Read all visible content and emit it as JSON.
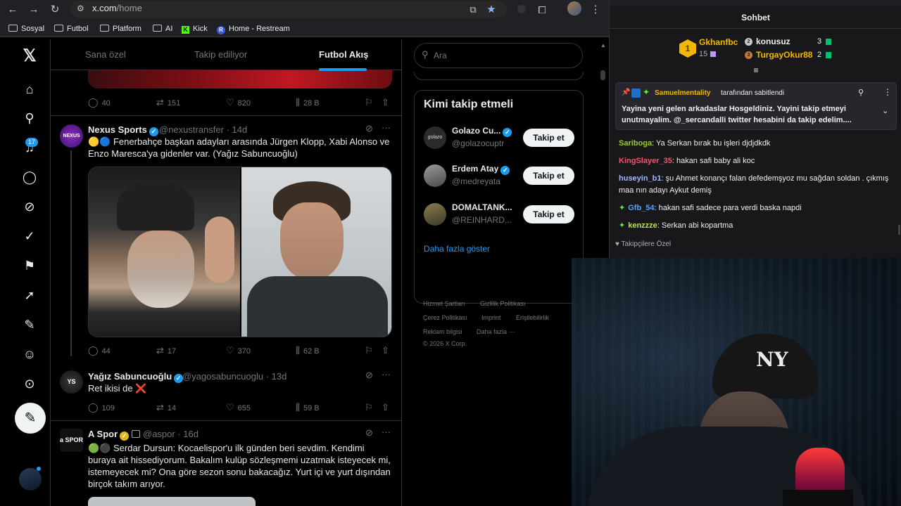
{
  "browser": {
    "url_domain": "x.com",
    "url_path": "/home",
    "bookmarks": [
      "Sosyal",
      "Futbol",
      "Platform",
      "AI",
      "Kick",
      "Home - Restream"
    ]
  },
  "twitter": {
    "tabs": [
      "Sana özel",
      "Takip ediliyor",
      "Futbol Akış"
    ],
    "notifications_badge": "17",
    "post0": {
      "replies": "40",
      "reposts": "151",
      "likes": "820",
      "views": "28 B"
    },
    "post1": {
      "name": "Nexus Sports",
      "avatar_text": "NEXUS",
      "handle_time": "@nexustransfer · 14d",
      "text": "🟡🔵 Fenerbahçe başkan adayları arasında Jürgen Klopp, Xabi Alonso ve Enzo  Maresca'ya gidenler var. (Yağız Sabuncuoğlu)",
      "replies": "44",
      "reposts": "17",
      "likes": "370",
      "views": "62 B"
    },
    "post2": {
      "name": "Yağız Sabuncuoğlu",
      "avatar_text": "YS",
      "handle_time": "@yagosabuncuoglu · 13d",
      "text": "Ret ikisi de ❌",
      "replies": "109",
      "reposts": "14",
      "likes": "655",
      "views": "59 B"
    },
    "post3": {
      "name": "A Spor",
      "avatar_text": "a SPOR",
      "handle_time": "@aspor · 16d",
      "text": "🟢⚫ Serdar Dursun: Kocaelispor'u ilk günden beri sevdim. Kendimi buraya ait hissediyorum. Bakalım kulüp sözleşmemi uzatmak isteyecek mi, istemeyecek mi? Ona göre sezon sonu bakacağız. Yurt içi ve yurt dışından birçok takım arıyor."
    },
    "search_placeholder": "Ara",
    "who_to_follow": {
      "title": "Kimi takip etmeli",
      "button": "Takip et",
      "show_more": "Daha fazla göster",
      "accounts": [
        {
          "name": "Golazo Cu...",
          "handle": "@golazocuptr",
          "avatar_text": "golazo"
        },
        {
          "name": "Erdem Atay",
          "handle": "@medreyata",
          "avatar_text": ""
        },
        {
          "name": "DOMALTANK...",
          "handle": "@REINHARD...",
          "avatar_text": ""
        }
      ]
    },
    "footer": {
      "links": [
        "Hizmet Şartları",
        "Gizlilik Politikası",
        "Çerez Politikası",
        "Imprint",
        "Erişilebilirlik",
        "Reklam bilgisi",
        "Daha fazla ···"
      ],
      "copyright": "© 2026 X Corp."
    }
  },
  "chat": {
    "header_title": "Sohbet",
    "leaderboard": {
      "rank1": {
        "name": "Gkhanfbc",
        "badge": "1",
        "count": "15"
      },
      "rank2": {
        "name": "konusuz",
        "count": "3"
      },
      "rank3": {
        "name": "TurgayOkur88",
        "count": "2"
      }
    },
    "pinned": {
      "by_user": "Samuelmentality",
      "by_text": "tarafından sabitlendi",
      "message": "Yayina yeni gelen arkadaslar Hosgeldiniz. Yayini takip etmeyi unutmayalim. @_sercandalli twitter hesabini da takip edelim...."
    },
    "messages": [
      {
        "user": "Sariboga",
        "color": "#9acd32",
        "text": "Ya Serkan bırak bu işleri djdjdkdk"
      },
      {
        "user": "KingSlayer_35",
        "color": "#ff4f6e",
        "text": "hakan safi baby ali koc"
      },
      {
        "user": "huseyin_b1",
        "color": "#a3b8ff",
        "text": "şu Ahmet konançı falan defedemşyoz mu sağdan soldan . çıkmış maa nın adayı Aykut demiş"
      },
      {
        "user": "Gfb_54",
        "color": "#4fa3ff",
        "text": "hakan safi sadece para verdi baska napdi"
      },
      {
        "user": "kenzzze",
        "color": "#b6e34a",
        "text": "Serkan abi kopartma"
      }
    ],
    "followers_only": "Takipçilere Özel"
  },
  "colors": {
    "twitter_blue": "#1d9bf0",
    "kick_green": "#53fc18",
    "chat_bg": "#18181b"
  }
}
